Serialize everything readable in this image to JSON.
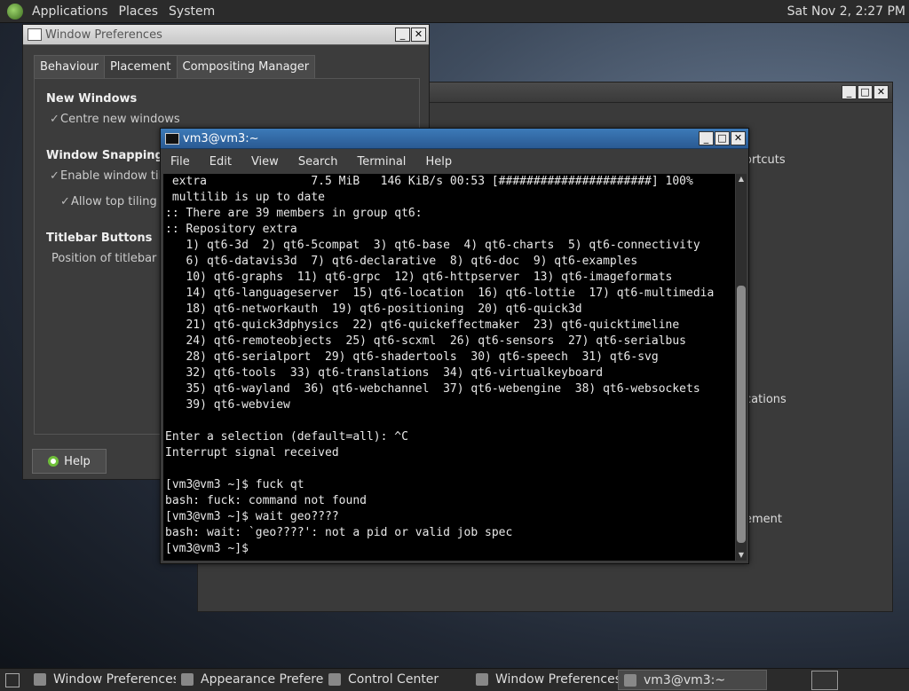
{
  "top_panel": {
    "menus": [
      "Applications",
      "Places",
      "System"
    ],
    "clock": "Sat Nov 2, 2:27 PM"
  },
  "bg_window": {
    "items": [
      "ortcuts",
      "cations",
      "ement"
    ]
  },
  "window_prefs": {
    "title": "Window Preferences",
    "tabs": [
      "Behaviour",
      "Placement",
      "Compositing Manager"
    ],
    "active_tab": "Placement",
    "sections": {
      "new_windows": "New Windows",
      "centre": "Centre new windows",
      "snapping": "Window Snapping",
      "enable_tiling": "Enable window tili",
      "top_tiling": "Allow top tiling",
      "titlebar": "Titlebar Buttons",
      "position": "Position of titlebar b"
    },
    "help": "Help"
  },
  "terminal": {
    "title": "vm3@vm3:~",
    "menus": [
      "File",
      "Edit",
      "View",
      "Search",
      "Terminal",
      "Help"
    ],
    "lines": [
      " extra               7.5 MiB   146 KiB/s 00:53 [######################] 100%",
      " multilib is up to date",
      ":: There are 39 members in group qt6:",
      ":: Repository extra",
      "   1) qt6-3d  2) qt6-5compat  3) qt6-base  4) qt6-charts  5) qt6-connectivity",
      "   6) qt6-datavis3d  7) qt6-declarative  8) qt6-doc  9) qt6-examples",
      "   10) qt6-graphs  11) qt6-grpc  12) qt6-httpserver  13) qt6-imageformats",
      "   14) qt6-languageserver  15) qt6-location  16) qt6-lottie  17) qt6-multimedia",
      "   18) qt6-networkauth  19) qt6-positioning  20) qt6-quick3d",
      "   21) qt6-quick3dphysics  22) qt6-quickeffectmaker  23) qt6-quicktimeline",
      "   24) qt6-remoteobjects  25) qt6-scxml  26) qt6-sensors  27) qt6-serialbus",
      "   28) qt6-serialport  29) qt6-shadertools  30) qt6-speech  31) qt6-svg",
      "   32) qt6-tools  33) qt6-translations  34) qt6-virtualkeyboard",
      "   35) qt6-wayland  36) qt6-webchannel  37) qt6-webengine  38) qt6-websockets",
      "   39) qt6-webview",
      "",
      "Enter a selection (default=all): ^C",
      "Interrupt signal received",
      "",
      "[vm3@vm3 ~]$ fuck qt",
      "bash: fuck: command not found",
      "[vm3@vm3 ~]$ wait geo????",
      "bash: wait: `geo????': not a pid or valid job spec",
      "[vm3@vm3 ~]$"
    ]
  },
  "taskbar": {
    "tasks": [
      {
        "label": "Window Preferences",
        "active": false
      },
      {
        "label": "Appearance Prefere...",
        "active": false
      },
      {
        "label": "Control Center",
        "active": false
      },
      {
        "label": "Window Preferences",
        "active": false
      },
      {
        "label": "vm3@vm3:~",
        "active": true
      }
    ]
  },
  "colors": {
    "terminal_titlebar": "#2f6aa6",
    "help_icon": "#6fbf3a"
  }
}
